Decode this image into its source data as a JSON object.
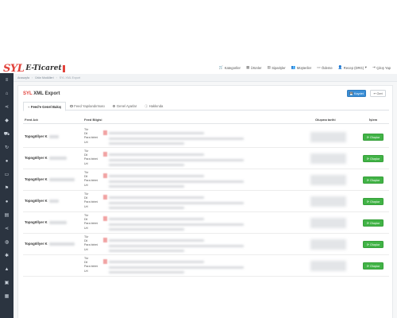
{
  "brand": {
    "logo_main": "SYL",
    "logo_text": "E-Ticaret",
    "logo_accent_color": "#e2423b"
  },
  "topnav": [
    {
      "icon": "shopping-cart-icon",
      "glyph": "🛒",
      "label": "Kategoriler"
    },
    {
      "icon": "box-icon",
      "glyph": "▦",
      "label": "Ürünler"
    },
    {
      "icon": "clipboard-icon",
      "glyph": "▤",
      "label": "Siparişler"
    },
    {
      "icon": "users-icon",
      "glyph": "👥",
      "label": "Müşteriler"
    },
    {
      "icon": "file-icon",
      "glyph": "▭",
      "label": "Ödeme"
    },
    {
      "icon": "user-icon",
      "glyph": "👤",
      "label": "Recep (DRG)",
      "has_caret": true
    },
    {
      "icon": "logout-icon",
      "glyph": "⇥",
      "label": "Çıkış Yap"
    }
  ],
  "breadcrumb": [
    "Anasayfa",
    "Ürün Modülleri",
    "SYL XML Export"
  ],
  "page": {
    "title_accent": "SYL",
    "title_rest": " XML Export",
    "save_button": "Kaydet",
    "back_button": "Geri"
  },
  "tabs": [
    {
      "label": "Feed'e Genel Bakış",
      "active": true,
      "icon": "rss-icon"
    },
    {
      "label": "Feed Yapılandırması",
      "active": false,
      "icon": "radio-icon"
    },
    {
      "label": "Genel Ayarlar",
      "active": false,
      "icon": "radio-icon"
    },
    {
      "label": "Hakkında",
      "active": false,
      "icon": "info-icon"
    }
  ],
  "table": {
    "headers": {
      "name": "Feed Adı",
      "info": "Feed Bilgisi",
      "date": "Oluşma tarihi",
      "action": "İşlem"
    },
    "info_labels": [
      "Tür",
      "Dil",
      "Para birimi",
      "Url"
    ],
    "action_label": "Oluştur",
    "rows": [
      {
        "name": "Topngöllyer K"
      },
      {
        "name": "Topngöllyer K"
      },
      {
        "name": "Topngöllyer K"
      },
      {
        "name": "Topngöllyer K"
      },
      {
        "name": "Topngöllyer K"
      },
      {
        "name": "Topngöllyer K"
      },
      {
        "name": ""
      }
    ]
  },
  "colors": {
    "sidebar": "#2b3440",
    "primary": "#3a8ed6",
    "success": "#41b346",
    "brand_red": "#e2423b"
  }
}
